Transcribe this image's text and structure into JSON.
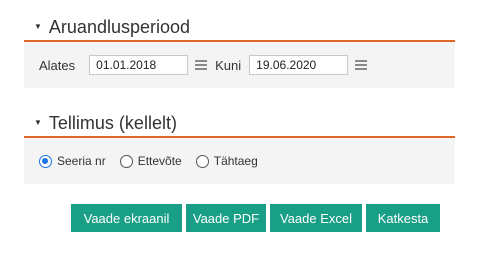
{
  "period_section": {
    "title": "Aruandlusperiood",
    "from_label": "Alates",
    "from_value": "01.01.2018",
    "to_label": "Kuni",
    "to_value": "19.06.2020"
  },
  "order_section": {
    "title": "Tellimus (kellelt)",
    "options": [
      {
        "label": "Seeria nr",
        "checked": true
      },
      {
        "label": "Ettevõte",
        "checked": false
      },
      {
        "label": "Tähtaeg",
        "checked": false
      }
    ]
  },
  "buttons": {
    "view_screen": "Vaade ekraanil",
    "view_pdf": "Vaade PDF",
    "view_excel": "Vaade Excel",
    "cancel": "Katkesta"
  },
  "colors": {
    "accent": "#e0662a",
    "button": "#1a9f87",
    "radio_checked": "#1a73e8"
  },
  "icons": {
    "section_toggle": "caret-down-icon",
    "date_picker": "calendar-icon"
  }
}
